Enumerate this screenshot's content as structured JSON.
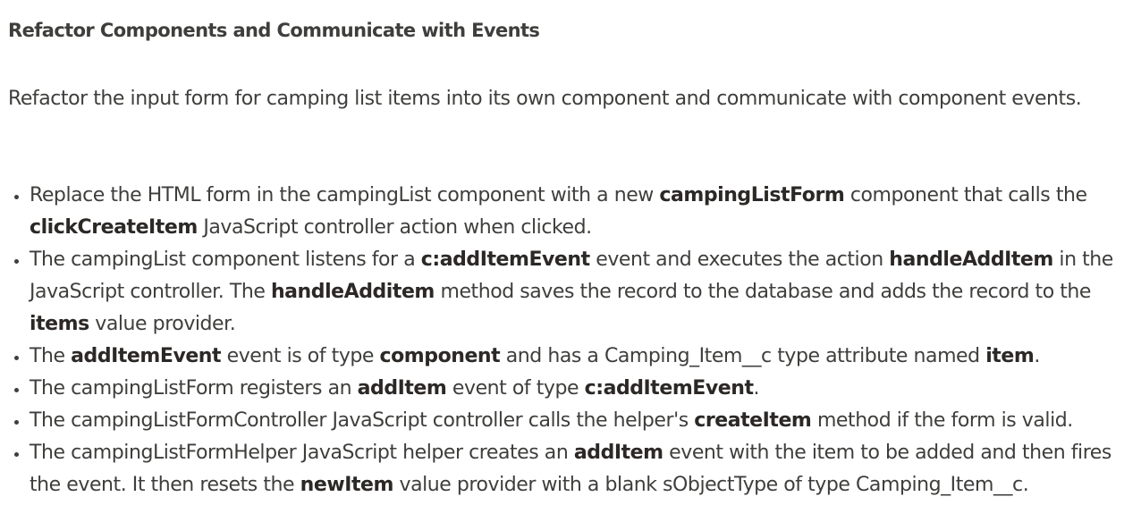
{
  "title": "Refactor Components and Communicate with Events",
  "intro": "Refactor the input form for camping list items into its own component and communicate with component events.",
  "requirements": [
    {
      "parts": [
        {
          "t": "Replace the HTML form in the campingList component with a new "
        },
        {
          "b": "campingListForm"
        },
        {
          "t": " component that calls the "
        },
        {
          "b": "clickCreateItem"
        },
        {
          "t": " JavaScript controller action when clicked."
        }
      ]
    },
    {
      "parts": [
        {
          "t": "The campingList component listens for a "
        },
        {
          "b": "c:addItemEvent"
        },
        {
          "t": " event and executes the action "
        },
        {
          "b": "handleAddItem"
        },
        {
          "t": " in the JavaScript controller. The "
        },
        {
          "b": "handleAdditem"
        },
        {
          "t": " method saves the record to the database and adds the record to the "
        },
        {
          "b": "items"
        },
        {
          "t": " value provider."
        }
      ]
    },
    {
      "parts": [
        {
          "t": "The "
        },
        {
          "b": "addItemEvent"
        },
        {
          "t": " event is of type "
        },
        {
          "b": "component"
        },
        {
          "t": " and has a Camping_Item__c type attribute named "
        },
        {
          "b": "item"
        },
        {
          "t": "."
        }
      ]
    },
    {
      "parts": [
        {
          "t": "The campingListForm registers an "
        },
        {
          "b": "addItem"
        },
        {
          "t": " event of type "
        },
        {
          "b": "c:addItemEvent"
        },
        {
          "t": "."
        }
      ]
    },
    {
      "parts": [
        {
          "t": "The campingListFormController JavaScript controller calls the helper's "
        },
        {
          "b": "createItem"
        },
        {
          "t": " method if the form is valid."
        }
      ]
    },
    {
      "parts": [
        {
          "t": "The campingListFormHelper JavaScript helper creates an "
        },
        {
          "b": "addItem"
        },
        {
          "t": " event with the item to be added and then fires the event. It then resets the "
        },
        {
          "b": "newItem"
        },
        {
          "t": " value provider with a blank sObjectType of type Camping_Item__c."
        }
      ]
    }
  ]
}
